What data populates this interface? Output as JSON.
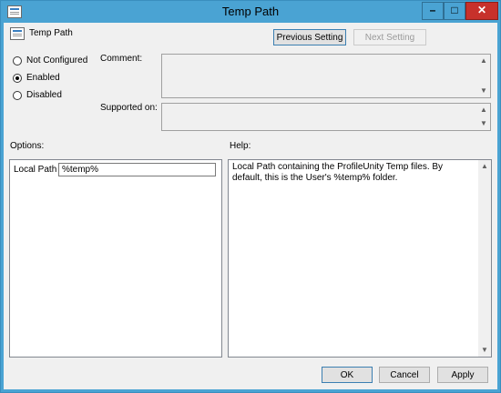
{
  "window": {
    "title": "Temp Path",
    "controls": {
      "minimize": "–",
      "maximize": "□",
      "close": "✕"
    }
  },
  "header": {
    "policy_name": "Temp Path",
    "previous_setting": "Previous Setting",
    "next_setting": "Next Setting"
  },
  "state": {
    "options": [
      {
        "label": "Not Configured",
        "checked": false
      },
      {
        "label": "Enabled",
        "checked": true
      },
      {
        "label": "Disabled",
        "checked": false
      }
    ]
  },
  "fields": {
    "comment_label": "Comment:",
    "supported_on_label": "Supported on:"
  },
  "options_section": {
    "label": "Options:",
    "local_path_label": "Local Path",
    "local_path_value": "%temp%"
  },
  "help_section": {
    "label": "Help:",
    "text": "Local Path containing the ProfileUnity Temp files. By default, this is the User's %temp% folder."
  },
  "footer": {
    "ok": "OK",
    "cancel": "Cancel",
    "apply": "Apply"
  },
  "icons": {
    "scroll_up": "▲",
    "scroll_down": "▼"
  }
}
